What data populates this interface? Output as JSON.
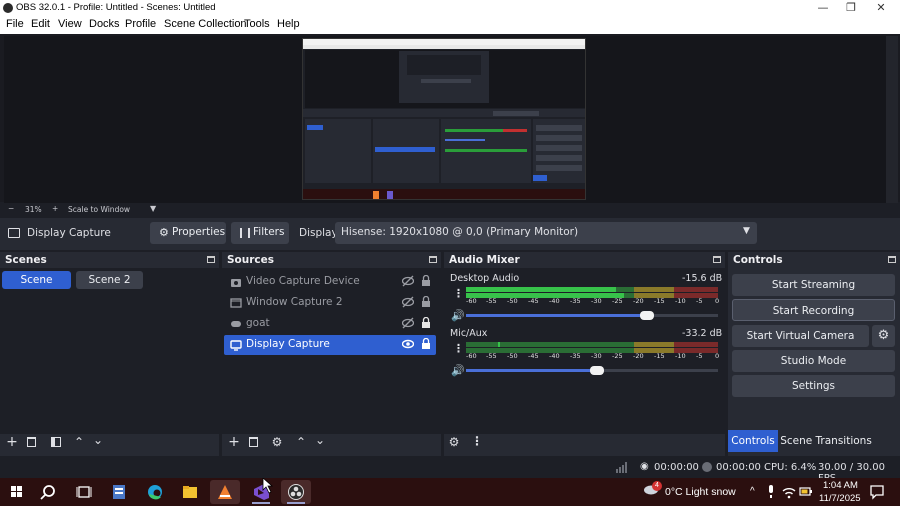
{
  "window": {
    "title": "OBS 32.0.1 - Profile: Untitled - Scenes: Untitled",
    "minimize": "—",
    "maximize": "❐",
    "close": "✕"
  },
  "menu": [
    "File",
    "Edit",
    "View",
    "Docks",
    "Profile",
    "Scene Collection",
    "Tools",
    "Help"
  ],
  "zoom": {
    "minus": "−",
    "percent": "31%",
    "plus": "+",
    "mode": "Scale to Window"
  },
  "context": {
    "source_name": "Display Capture",
    "properties_label": "Properties",
    "filters_label": "Filters",
    "display_label": "Display",
    "display_value": "Hisense: 1920x1080 @ 0,0 (Primary Monitor)"
  },
  "scenes": {
    "title": "Scenes",
    "items": [
      "Scene",
      "Scene 2"
    ]
  },
  "sources": {
    "title": "Sources",
    "items": [
      {
        "label": "Video Capture Device",
        "icon": "camera-icon",
        "visible": false,
        "locked": true
      },
      {
        "label": "Window Capture 2",
        "icon": "window-icon",
        "visible": false,
        "locked": true
      },
      {
        "label": "goat",
        "icon": "gamepad-icon",
        "visible": false,
        "locked": true
      },
      {
        "label": "Display Capture",
        "icon": "monitor-icon",
        "visible": true,
        "locked": true
      }
    ]
  },
  "audio_mixer": {
    "title": "Audio Mixer",
    "channels": [
      {
        "name": "Desktop Audio",
        "db": "-15.6 dB",
        "volume": 0.72
      },
      {
        "name": "Mic/Aux",
        "db": "-33.2 dB",
        "volume": 0.52
      }
    ],
    "ticks": [
      "-60",
      "-55",
      "-50",
      "-45",
      "-40",
      "-35",
      "-30",
      "-25",
      "-20",
      "-15",
      "-10",
      "-5",
      "0"
    ]
  },
  "controls": {
    "title": "Controls",
    "start_streaming": "Start Streaming",
    "start_recording": "Start Recording",
    "start_virtual_camera": "Start Virtual Camera",
    "studio_mode": "Studio Mode",
    "settings": "Settings",
    "tab_controls": "Controls",
    "tab_transitions": "Scene Transitions"
  },
  "status": {
    "stream_time": "00:00:00",
    "record_time": "00:00:00",
    "cpu": "CPU: 6.4%",
    "fps": "30.00 / 30.00 FPS"
  },
  "taskbar": {
    "weather_badge": "4",
    "weather": "0°C  Light snow",
    "time": "1:04 AM",
    "date": "11/7/2025",
    "chevron": "^"
  },
  "colors": {
    "accent": "#2f5fd0",
    "panel": "#272a33",
    "panel_dark": "#1d1f26",
    "button": "#3c404b",
    "taskbar": "#2b0f0f"
  }
}
